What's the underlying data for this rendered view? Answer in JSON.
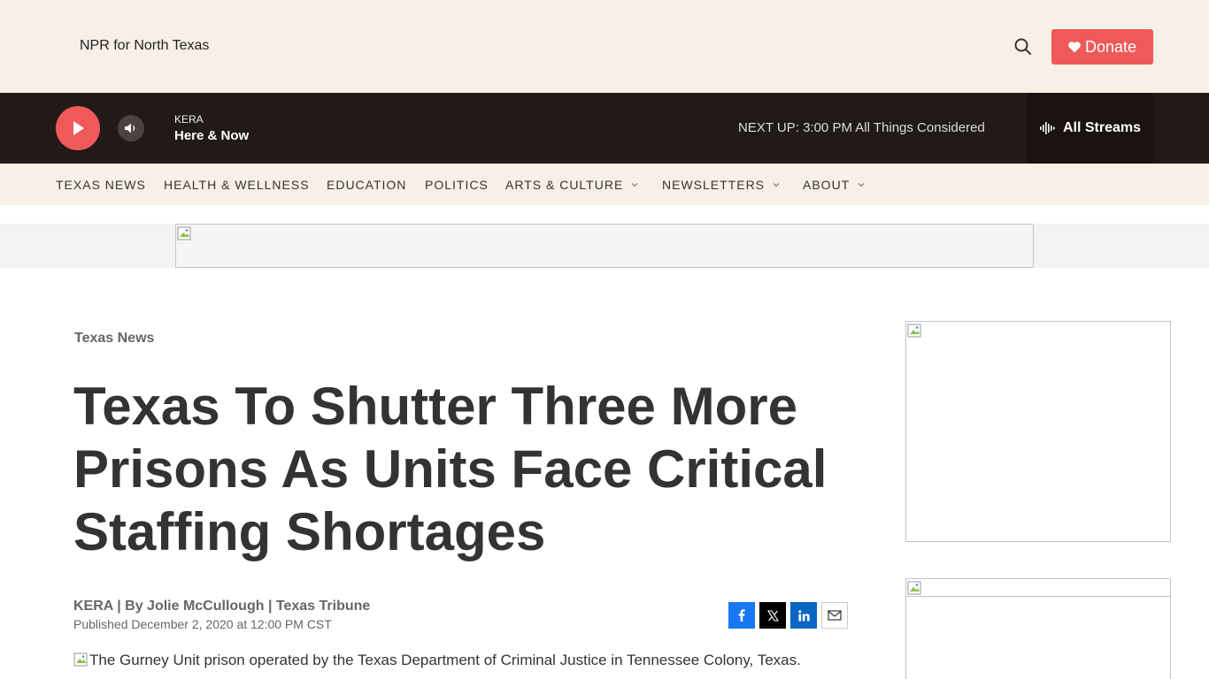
{
  "header": {
    "site_name": "NPR for North Texas",
    "donate_label": "Donate",
    "accent_color": "#f05959"
  },
  "player": {
    "station": "KERA",
    "program": "Here & Now",
    "next_up_label": "NEXT UP:",
    "next_up_time": "3:00 PM",
    "next_up_show": "All Things Considered",
    "streams_label": "All Streams"
  },
  "nav": {
    "items": [
      {
        "label": "TEXAS NEWS"
      },
      {
        "label": "HEALTH & WELLNESS"
      },
      {
        "label": "EDUCATION"
      },
      {
        "label": "POLITICS"
      },
      {
        "label": "ARTS & CULTURE"
      },
      {
        "label": "NEWSLETTERS"
      },
      {
        "label": "ABOUT"
      }
    ]
  },
  "article": {
    "category": "Texas News",
    "headline": "Texas To Shutter Three More Prisons As Units Face Critical Staffing Shortages",
    "byline_org": "KERA",
    "byline_sep1": "|",
    "byline_author": "By Jolie McCullough",
    "byline_sep2": "|",
    "byline_partner": "Texas Tribune",
    "published": "Published December 2, 2020 at 12:00 PM CST",
    "image_alt": "The Gurney Unit prison operated by the Texas Department of Criminal Justice in Tennessee Colony, Texas."
  }
}
